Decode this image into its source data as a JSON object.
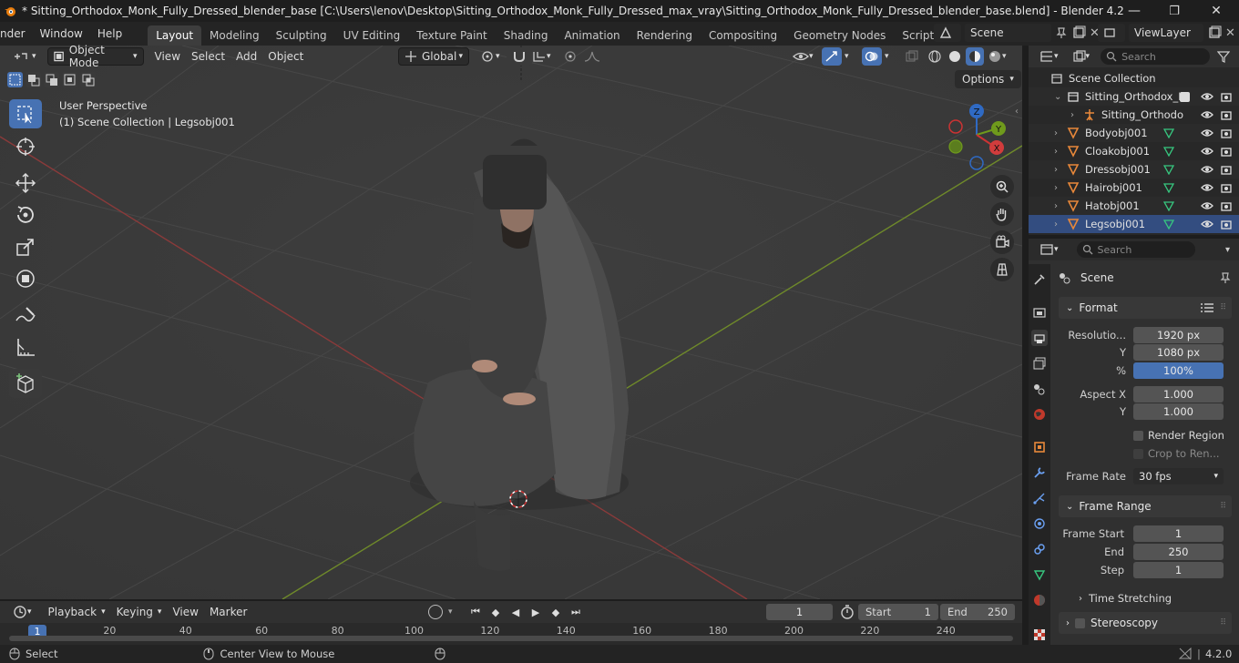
{
  "window": {
    "title": "* Sitting_Orthodox_Monk_Fully_Dressed_blender_base [C:\\Users\\lenov\\Desktop\\Sitting_Orthodox_Monk_Fully_Dressed_max_vray\\Sitting_Orthodox_Monk_Fully_Dressed_blender_base.blend] - Blender 4.2",
    "minimize": "—",
    "maximize": "❐",
    "close": "✕"
  },
  "menu": [
    "nder",
    "Window",
    "Help"
  ],
  "workspaces": [
    {
      "label": "Layout",
      "active": true
    },
    {
      "label": "Modeling"
    },
    {
      "label": "Sculpting"
    },
    {
      "label": "UV Editing"
    },
    {
      "label": "Texture Paint"
    },
    {
      "label": "Shading"
    },
    {
      "label": "Animation"
    },
    {
      "label": "Rendering"
    },
    {
      "label": "Compositing"
    },
    {
      "label": "Geometry Nodes"
    },
    {
      "label": "Scripting"
    }
  ],
  "add_workspace": "+",
  "scene_field": "Scene",
  "viewlayer_field": "ViewLayer",
  "viewport": {
    "mode": "Object Mode",
    "menus": [
      "View",
      "Select",
      "Add",
      "Object"
    ],
    "orientation": "Global",
    "options": "Options",
    "perspective": "User Perspective",
    "collection_info": "(1) Scene Collection | Legsobj001",
    "gizmo": {
      "x": "X",
      "y": "Y",
      "z": "Z"
    },
    "colors": {
      "x_axis": "#8a3a3a",
      "y_axis": "#6f8a2a",
      "grid": "#444444",
      "background": "#3a3a3a"
    }
  },
  "outliner": {
    "search_placeholder": "Search",
    "rows": [
      {
        "label": "Scene Collection",
        "indent": 0,
        "type": "scene"
      },
      {
        "label": "Sitting_Orthodox_M",
        "indent": 1,
        "type": "collection"
      },
      {
        "label": "Sitting_Orthodo",
        "indent": 2,
        "type": "armature"
      },
      {
        "label": "Bodyobj001",
        "indent": 1,
        "type": "mesh"
      },
      {
        "label": "Cloakobj001",
        "indent": 1,
        "type": "mesh"
      },
      {
        "label": "Dressobj001",
        "indent": 1,
        "type": "mesh"
      },
      {
        "label": "Hairobj001",
        "indent": 1,
        "type": "mesh"
      },
      {
        "label": "Hatobj001",
        "indent": 1,
        "type": "mesh"
      },
      {
        "label": "Legsobj001",
        "indent": 1,
        "type": "mesh",
        "active": true
      }
    ]
  },
  "properties": {
    "search_placeholder": "Search",
    "context": "Scene",
    "format": {
      "header": "Format",
      "resolution_x_label": "Resolutio...",
      "resolution_x": "1920 px",
      "resolution_y_label": "Y",
      "resolution_y": "1080 px",
      "percent_label": "%",
      "percent": "100%",
      "aspect_x_label": "Aspect X",
      "aspect_x": "1.000",
      "aspect_y_label": "Y",
      "aspect_y": "1.000",
      "render_region": "Render Region",
      "crop": "Crop to Ren...",
      "frame_rate_label": "Frame Rate",
      "frame_rate": "30 fps"
    },
    "frame_range": {
      "header": "Frame Range",
      "start_label": "Frame Start",
      "start": "1",
      "end_label": "End",
      "end": "250",
      "step_label": "Step",
      "step": "1",
      "time_stretching": "Time Stretching"
    },
    "stereoscopy": "Stereoscopy"
  },
  "timeline": {
    "menus": [
      "Playback",
      "Keying",
      "View",
      "Marker"
    ],
    "current_frame": "1",
    "start_label": "Start",
    "start": "1",
    "end_label": "End",
    "end": "250",
    "ticks": [
      "1",
      "20",
      "40",
      "60",
      "80",
      "100",
      "120",
      "140",
      "160",
      "180",
      "200",
      "220",
      "240"
    ]
  },
  "status": {
    "select": "Select",
    "center": "Center View to Mouse",
    "version": "4.2.0"
  }
}
